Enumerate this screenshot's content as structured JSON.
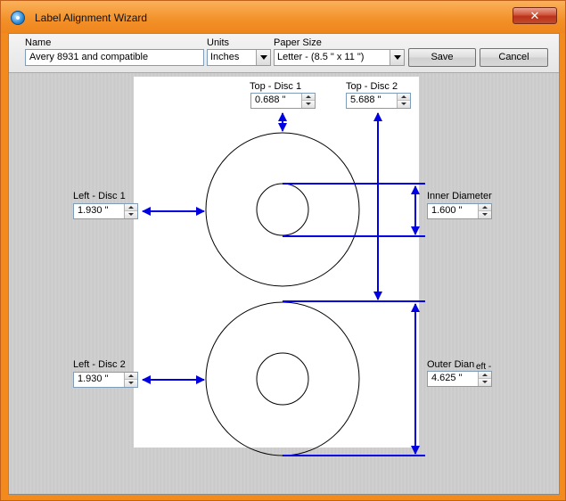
{
  "window": {
    "title": "Label Alignment Wizard",
    "close_glyph": "✕"
  },
  "toolbar": {
    "name_label": "Name",
    "name_value": "Avery 8931 and compatible",
    "units_label": "Units",
    "units_value": "Inches",
    "paper_label": "Paper Size",
    "paper_value": "Letter - (8.5 \" x 11 \")",
    "save_label": "Save",
    "cancel_label": "Cancel"
  },
  "measurements": {
    "top_disc1": {
      "label": "Top - Disc 1",
      "value": "0.688 \""
    },
    "top_disc2": {
      "label": "Top - Disc 2",
      "value": "5.688 \""
    },
    "left_disc1": {
      "label": "Left - Disc 1",
      "value": "1.930 \""
    },
    "left_disc2": {
      "label": "Left - Disc 2",
      "value": "1.930 \""
    },
    "inner_diameter": {
      "label": "Inner Diameter",
      "value": "1.600 \""
    },
    "outer_diameter": {
      "label": "Outer Dian",
      "value": "4.625 \"",
      "overlap_text": "eft -"
    }
  },
  "colors": {
    "accent": "#0000e0",
    "titlebar": "#f28a1d"
  }
}
